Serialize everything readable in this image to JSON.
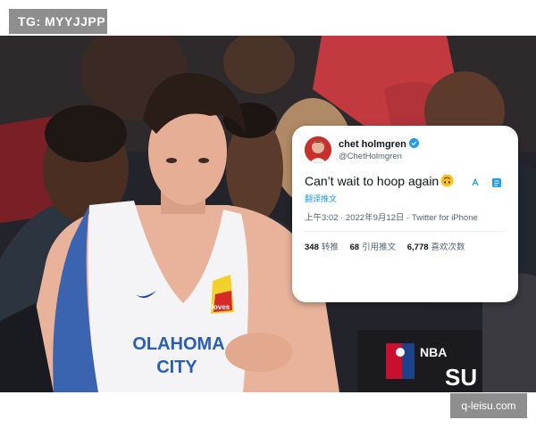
{
  "badge": {
    "text": "TG: MYYJJPP"
  },
  "jersey": {
    "team_text": "OLAHOMA",
    "city_text": "CITY",
    "sponsor_text": "loves"
  },
  "banner": {
    "text": "NBA",
    "sub_text": "SU"
  },
  "tweet": {
    "display_name": "chet holmgren",
    "handle": "@ChetHolmgren",
    "text": "Can’t wait to hoop again",
    "translate_label": "翻译推文",
    "meta": "上午3:02 · 2022年9月12日 · Twitter for iPhone",
    "stats": [
      {
        "count": "348",
        "label": "转推"
      },
      {
        "count": "68",
        "label": "引用推文"
      },
      {
        "count": "6,778",
        "label": "喜欢次数"
      }
    ],
    "verified_icon": "verified-badge-icon",
    "emoji_icon": "upside-down-face-emoji",
    "accent_color": "#1d9bf0"
  },
  "watermark": {
    "text": "q-leisu.com"
  }
}
